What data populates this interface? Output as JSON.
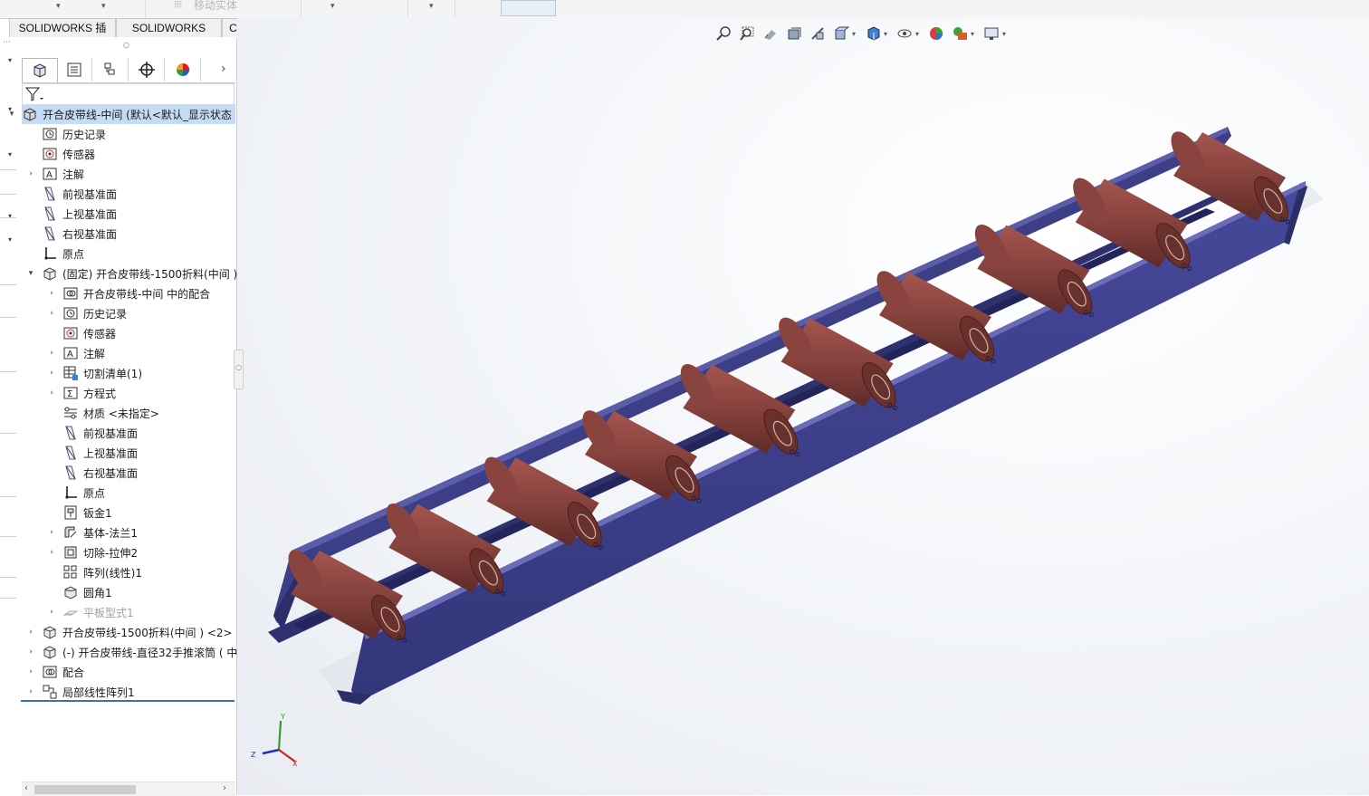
{
  "ribbon_remnant": {
    "ghost_label": "移动实体"
  },
  "command_tabs": [
    {
      "label": "SOLIDWORKS 插件"
    },
    {
      "label": "SOLIDWORKS MBD"
    },
    {
      "label": "CircuitWorks"
    }
  ],
  "panel_tabs": [
    {
      "icon": "featuremanager-tree-icon"
    },
    {
      "icon": "propertymanager-icon"
    },
    {
      "icon": "configurationmanager-icon"
    },
    {
      "icon": "dimxpert-icon"
    },
    {
      "icon": "displaymanager-icon"
    }
  ],
  "tree": {
    "root": "开合皮带线-中间  (默认<默认_显示状态",
    "items": [
      {
        "label": "历史记录"
      },
      {
        "label": "传感器"
      },
      {
        "label": "注解"
      },
      {
        "label": "前视基准面"
      },
      {
        "label": "上视基准面"
      },
      {
        "label": "右视基准面"
      },
      {
        "label": "原点"
      },
      {
        "label": "(固定) 开合皮带线-1500折料(中间 )"
      },
      {
        "label": "开合皮带线-中间 中的配合"
      },
      {
        "label": "历史记录"
      },
      {
        "label": "传感器"
      },
      {
        "label": "注解"
      },
      {
        "label": "切割清单(1)"
      },
      {
        "label": "方程式"
      },
      {
        "label": "材质 <未指定>"
      },
      {
        "label": "前视基准面"
      },
      {
        "label": "上视基准面"
      },
      {
        "label": "右视基准面"
      },
      {
        "label": "原点"
      },
      {
        "label": "钣金1"
      },
      {
        "label": "基体-法兰1"
      },
      {
        "label": "切除-拉伸2"
      },
      {
        "label": "阵列(线性)1"
      },
      {
        "label": "圆角1"
      },
      {
        "label": "平板型式1"
      },
      {
        "label": "开合皮带线-1500折料(中间 ) <2>"
      },
      {
        "label": "(-) 开合皮带线-直径32手推滚筒 ( 中"
      },
      {
        "label": "配合"
      },
      {
        "label": "局部线性阵列1"
      }
    ]
  },
  "triad": {
    "x": "X",
    "y": "Y",
    "z": "Z"
  },
  "colors": {
    "frame": "#3d3f86",
    "frame_dark": "#2c2e68",
    "roller": "#8a4440",
    "roller_dark": "#6a302c",
    "selection": "#c6dcf5"
  }
}
